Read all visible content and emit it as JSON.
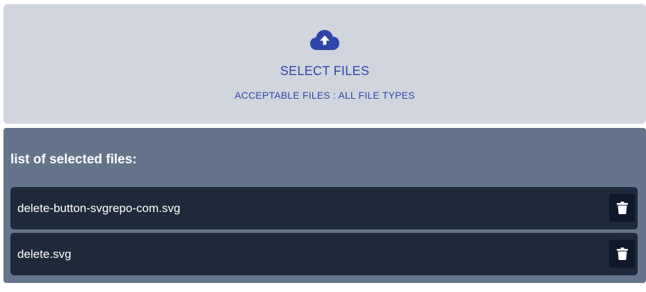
{
  "upload": {
    "icon": "cloud-upload-icon",
    "title": "SELECT FILES",
    "acceptable": "ACCEPTABLE FILES : ALL FILE TYPES",
    "color": "#2d46a8"
  },
  "files": {
    "heading": "list of selected files:",
    "items": [
      {
        "name": "delete-button-svgrepo-com.svg",
        "icon": "trash-icon"
      },
      {
        "name": "delete.svg",
        "icon": "trash-icon"
      }
    ]
  },
  "colors": {
    "dropzone_bg": "#d1d5de",
    "panel_bg": "#64748b",
    "row_bg": "#1e293b",
    "button_bg": "#0f172a"
  }
}
